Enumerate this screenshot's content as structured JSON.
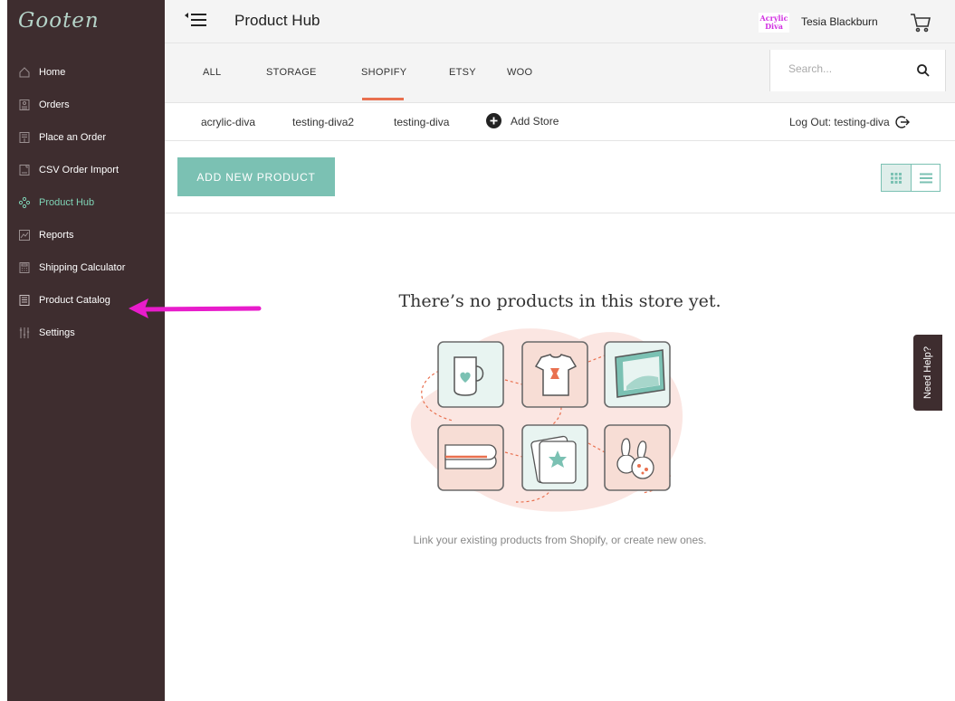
{
  "brand": {
    "logo_text": "Gooten"
  },
  "sidebar": {
    "items": [
      {
        "label": "Home",
        "icon": "home-icon"
      },
      {
        "label": "Orders",
        "icon": "orders-icon"
      },
      {
        "label": "Place an Order",
        "icon": "place-order-icon"
      },
      {
        "label": "CSV Order Import",
        "icon": "csv-import-icon"
      },
      {
        "label": "Product Hub",
        "icon": "product-hub-icon",
        "active": true
      },
      {
        "label": "Reports",
        "icon": "reports-icon"
      },
      {
        "label": "Shipping Calculator",
        "icon": "calculator-icon"
      },
      {
        "label": "Product Catalog",
        "icon": "catalog-icon"
      },
      {
        "label": "Settings",
        "icon": "settings-sliders-icon"
      }
    ]
  },
  "header": {
    "title": "Product Hub",
    "store_logo_line1": "Acrylic",
    "store_logo_line2": "Diva",
    "user_name": "Tesia Blackburn"
  },
  "tabs": {
    "items": [
      "ALL",
      "STORAGE",
      "SHOPIFY",
      "ETSY",
      "WOO"
    ],
    "active": "SHOPIFY"
  },
  "search": {
    "placeholder": "Search...",
    "value": ""
  },
  "stores": {
    "items": [
      "acrylic-diva",
      "testing-diva2",
      "testing-diva"
    ],
    "active": "testing-diva",
    "add_label": "Add Store",
    "logout_label": "Log Out: testing-diva"
  },
  "actions": {
    "add_product_label": "ADD NEW PRODUCT"
  },
  "empty_state": {
    "title": "There’s no products in this store yet.",
    "subtitle": "Link your existing products from Shopify, or create new ones."
  },
  "help": {
    "label": "Need Help?"
  },
  "colors": {
    "sidebar": "#3e2d2f",
    "accent": "#7bc1b3",
    "active_nav": "#7fd3b6",
    "tab_underline": "#e9704f",
    "annotation": "#e81ccb"
  }
}
